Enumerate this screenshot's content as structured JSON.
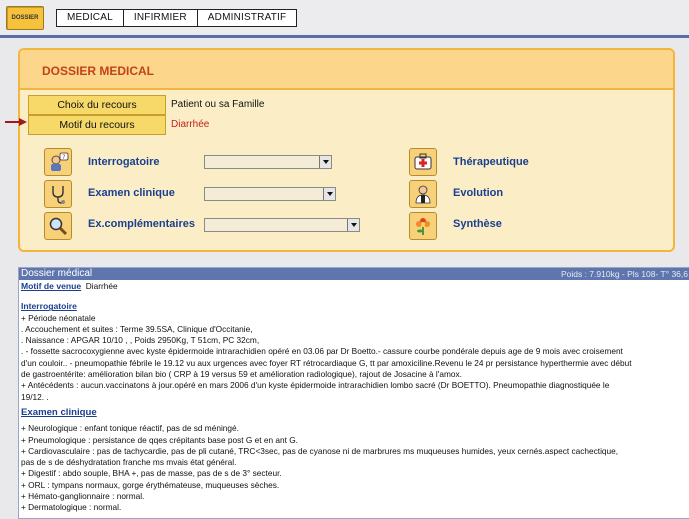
{
  "topbar": {
    "dossier_icon_label": "DOSSIER",
    "tabs": [
      "MEDICAL",
      "INFIRMIER",
      "ADMINISTRATIF"
    ]
  },
  "panel": {
    "title": "DOSSIER MEDICAL",
    "choix_label": "Choix du recours",
    "choix_value": "Patient ou sa Famille",
    "motif_label": "Motif du recours",
    "motif_value": "Diarrhée",
    "left_rows": [
      {
        "label": "Interrogatoire",
        "icon": "question-person-icon"
      },
      {
        "label": "Examen clinique",
        "icon": "stethoscope-icon"
      },
      {
        "label": "Ex.complémentaires",
        "icon": "magnifier-icon"
      }
    ],
    "right_rows": [
      {
        "label": "Thérapeutique",
        "icon": "medkit-icon"
      },
      {
        "label": "Evolution",
        "icon": "doctor-icon"
      },
      {
        "label": "Synthèse",
        "icon": "flower-icon"
      }
    ]
  },
  "record": {
    "title": "Dossier médical",
    "vitals": "Poids : 7.910kg - Pls 108- T° 36,6",
    "motif_heading": "Motif de venue",
    "motif_value": "Diarrhée",
    "interrogatoire_heading": "Interrogatoire",
    "interrogatoire_lines": [
      "+ Période néonatale",
      ". Accouchement et suites : Terme 39.5SA, Clinique d'Occitanie,",
      ". Naissance : APGAR 10/10 , , Poids 2950Kg, T 51cm, PC 32cm,",
      ". - fossette sacrocoxygienne avec kyste épidermoide intrarachidien opéré en 03.06 par Dr Boetto.- cassure courbe pondérale depuis age de 9 mois avec croisement",
      "d'un couloir.. - pneumopathie fébrile le 19.12 vu aux urgences avec foyer RT rétrocardiaque G, tt par amoxiciline.Revenu le 24 pr persistance hyperthermie avec début",
      "de gastroentérite: amélioration bilan bio ( CRP à 19 versus 59 et amélioration radiologique), rajout de Josacine à l'amox.",
      "+ Antécédents : aucun.vaccinatons à jour.opéré en mars 2006 d'un kyste épidermoide intrarachidien lombo sacré (Dr BOETTO). Pneumopathie diagnostiquée le",
      "19/12. ."
    ],
    "examen_heading": "Examen clinique",
    "examen_lines": [
      "+ Neurologique : enfant tonique réactif, pas de sd méningé.",
      "+ Pneumologique : persistance de qqes crépitants base post G et en ant G.",
      "+ Cardiovasculaire : pas de tachycardie, pas de pli cutané, TRC<3sec, pas de cyanose ni de marbrures ms muqueuses humides, yeux cernés.aspect cachectique,",
      "pas de s de déshydratation franche ms mvais état général.",
      "+ Digestif : abdo souple, BHA +, pas de masse, pas de s de 3° secteur.",
      "+ ORL : tympans normaux, gorge érythémateuse, muqueuses sèches.",
      "+ Hémato-ganglionnaire : normal.",
      "+ Dermatologique : normal."
    ]
  },
  "colors": {
    "accent_orange": "#f3b53c",
    "title_red": "#c0431c",
    "link_blue": "#1a3f8e",
    "header_blue": "#5e75ad",
    "arrow_red": "#a11a1a"
  }
}
